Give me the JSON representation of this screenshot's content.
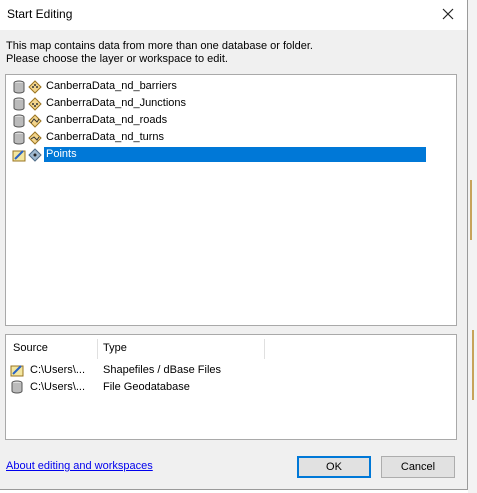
{
  "window": {
    "title": "Start Editing"
  },
  "message": {
    "line1": "This map contains data from more than one database or folder.",
    "line2": "Please choose the layer or workspace to edit."
  },
  "layers": [
    {
      "label": "CanberraData_nd_barriers",
      "icon": "point-feature-class-icon"
    },
    {
      "label": "CanberraData_nd_Junctions",
      "icon": "point-feature-class-icon"
    },
    {
      "label": "CanberraData_nd_roads",
      "icon": "line-feature-class-icon"
    },
    {
      "label": "CanberraData_nd_turns",
      "icon": "line-feature-class-icon"
    },
    {
      "label": "Points",
      "icon": "point-feature-class-icon",
      "selected": true
    }
  ],
  "workspaces": {
    "headers": {
      "source": "Source",
      "type": "Type"
    },
    "rows": [
      {
        "source": "C:\\Users\\...",
        "type": "Shapefiles / dBase Files",
        "icon": "shapefile-workspace-icon"
      },
      {
        "source": "C:\\Users\\...",
        "type": "File Geodatabase",
        "icon": "geodatabase-icon"
      }
    ]
  },
  "footer": {
    "help_link": "About editing and workspaces",
    "ok_label": "OK",
    "cancel_label": "Cancel"
  },
  "colors": {
    "selection": "#0078d7",
    "link": "#0000ee"
  }
}
